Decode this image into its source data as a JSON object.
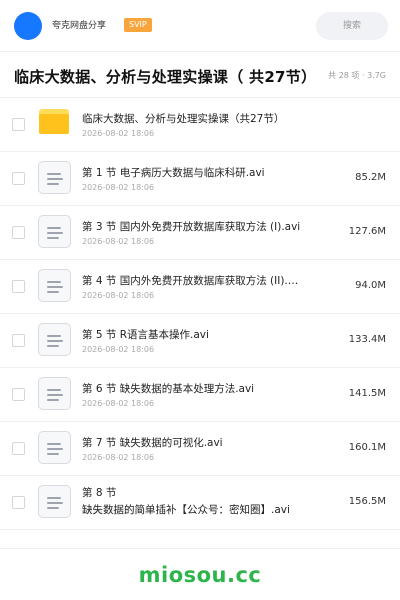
{
  "header": {
    "owner_name": "夸克网盘分享",
    "badge": "SVIP",
    "search_placeholder": "搜索"
  },
  "title": {
    "text": "临床大数据、分析与处理实操课（ 共27节）",
    "summary": "共 28 项 · 3.7G"
  },
  "files": [
    {
      "name": "临床大数据、分析与处理实操课（共27节）",
      "date": "2026-08-02 18:06",
      "size": "",
      "type": "folder"
    },
    {
      "name": "第 1 节 电子病历大数据与临床科研.avi",
      "date": "2026-08-02 18:06",
      "size": "85.2M",
      "type": "video"
    },
    {
      "name": "第 3 节 国内外免费开放数据库获取方法 (I).avi",
      "date": "2026-08-02 18:06",
      "size": "127.6M",
      "type": "video"
    },
    {
      "name": "第 4 节 国内外免费开放数据库获取方法 (II).avi",
      "date": "2026-08-02 18:06",
      "size": "94.0M",
      "type": "video"
    },
    {
      "name": "第 5 节 R语言基本操作.avi",
      "date": "2026-08-02 18:06",
      "size": "133.4M",
      "type": "video"
    },
    {
      "name": "第 6 节 缺失数据的基本处理方法.avi",
      "date": "2026-08-02 18:06",
      "size": "141.5M",
      "type": "video"
    },
    {
      "name": "第 7 节 缺失数据的可视化.avi",
      "date": "2026-08-02 18:06",
      "size": "160.1M",
      "type": "video"
    },
    {
      "name_line1": "第 8 节",
      "name_line2": "缺失数据的简单插补【公众号：密知圈】.avi",
      "date": "2026-08-02 18:06",
      "size": "156.5M",
      "type": "video"
    }
  ],
  "footer": {
    "brand": "miosou.cc"
  }
}
